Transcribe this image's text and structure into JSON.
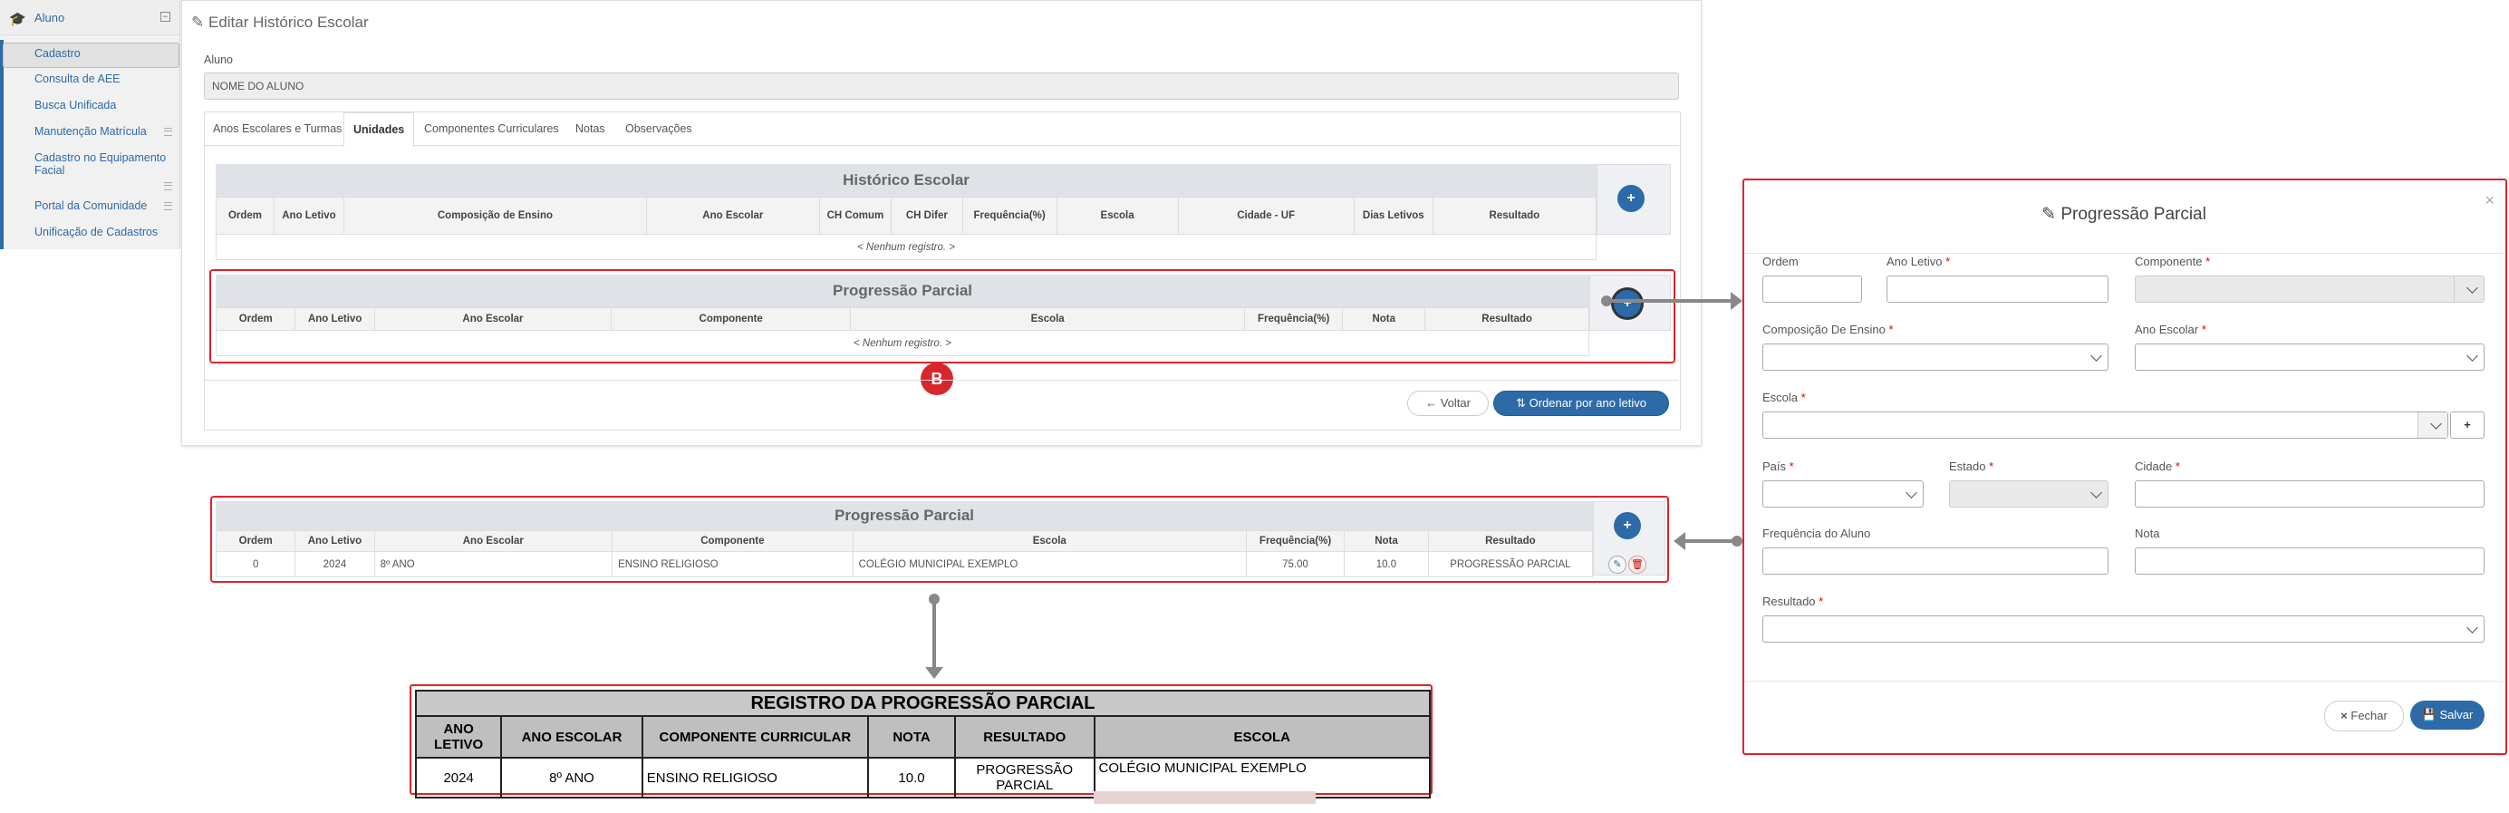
{
  "sidebar": {
    "header": "Aluno",
    "items": [
      "Cadastro",
      "Consulta de AEE",
      "Busca Unificada",
      "Manutenção Matrícula",
      "Cadastro no Equipamento",
      "Facial",
      "Portal da Comunidade",
      "Unificação de Cadastros"
    ]
  },
  "main": {
    "title": "Editar Histórico Escolar",
    "aluno_label": "Aluno",
    "aluno_value": "NOME DO ALUNO",
    "tabs": [
      "Anos Escolares e Turmas",
      "Unidades",
      "Componentes Curriculares",
      "Notas",
      "Observações"
    ],
    "historico": {
      "title": "Histórico Escolar",
      "columns": [
        "Ordem",
        "Ano Letivo",
        "Composição de Ensino",
        "Ano Escolar",
        "CH Comum",
        "CH Difer",
        "Frequência(%)",
        "Escola",
        "Cidade - UF",
        "Dias Letivos",
        "Resultado"
      ],
      "empty": "< Nenhum registro. >"
    },
    "progressao": {
      "title": "Progressão Parcial",
      "columns": [
        "Ordem",
        "Ano Letivo",
        "Ano Escolar",
        "Componente",
        "Escola",
        "Frequência(%)",
        "Nota",
        "Resultado"
      ],
      "empty": "< Nenhum registro. >"
    },
    "btn_voltar": "Voltar",
    "btn_ordenar": "Ordenar por ano letivo"
  },
  "badge": "B",
  "progressao_filled": {
    "title": "Progressão Parcial",
    "columns": [
      "Ordem",
      "Ano Letivo",
      "Ano Escolar",
      "Componente",
      "Escola",
      "Frequência(%)",
      "Nota",
      "Resultado"
    ],
    "row": [
      "0",
      "2024",
      "8º ANO",
      "ENSINO RELIGIOSO",
      "COLÉGIO MUNICIPAL EXEMPLO",
      "75.00",
      "10.0",
      "PROGRESSÃO PARCIAL"
    ]
  },
  "modal": {
    "title": "Progressão Parcial",
    "close": "×",
    "fields": {
      "ordem": "Ordem",
      "ano_letivo": "Ano Letivo",
      "componente": "Componente",
      "composicao": "Composição De Ensino",
      "ano_escolar": "Ano Escolar",
      "escola": "Escola",
      "pais": "País",
      "estado": "Estado",
      "cidade": "Cidade",
      "frequencia": "Frequência do Aluno",
      "nota": "Nota",
      "resultado": "Resultado"
    },
    "required_mark": "*",
    "btn_fechar": "Fechar",
    "btn_salvar": "Salvar"
  },
  "report": {
    "title": "REGISTRO DA PROGRESSÃO PARCIAL",
    "columns": [
      "ANO LETIVO",
      "ANO ESCOLAR",
      "COMPONENTE CURRICULAR",
      "NOTA",
      "RESULTADO",
      "ESCOLA"
    ],
    "row": [
      "2024",
      "8º ANO",
      "ENSINO RELIGIOSO",
      "10.0",
      "PROGRESSÃO PARCIAL",
      "COLÉGIO MUNICIPAL EXEMPLO"
    ]
  },
  "colors": {
    "primary": "#2c6aa8",
    "highlight": "#e0222a"
  }
}
